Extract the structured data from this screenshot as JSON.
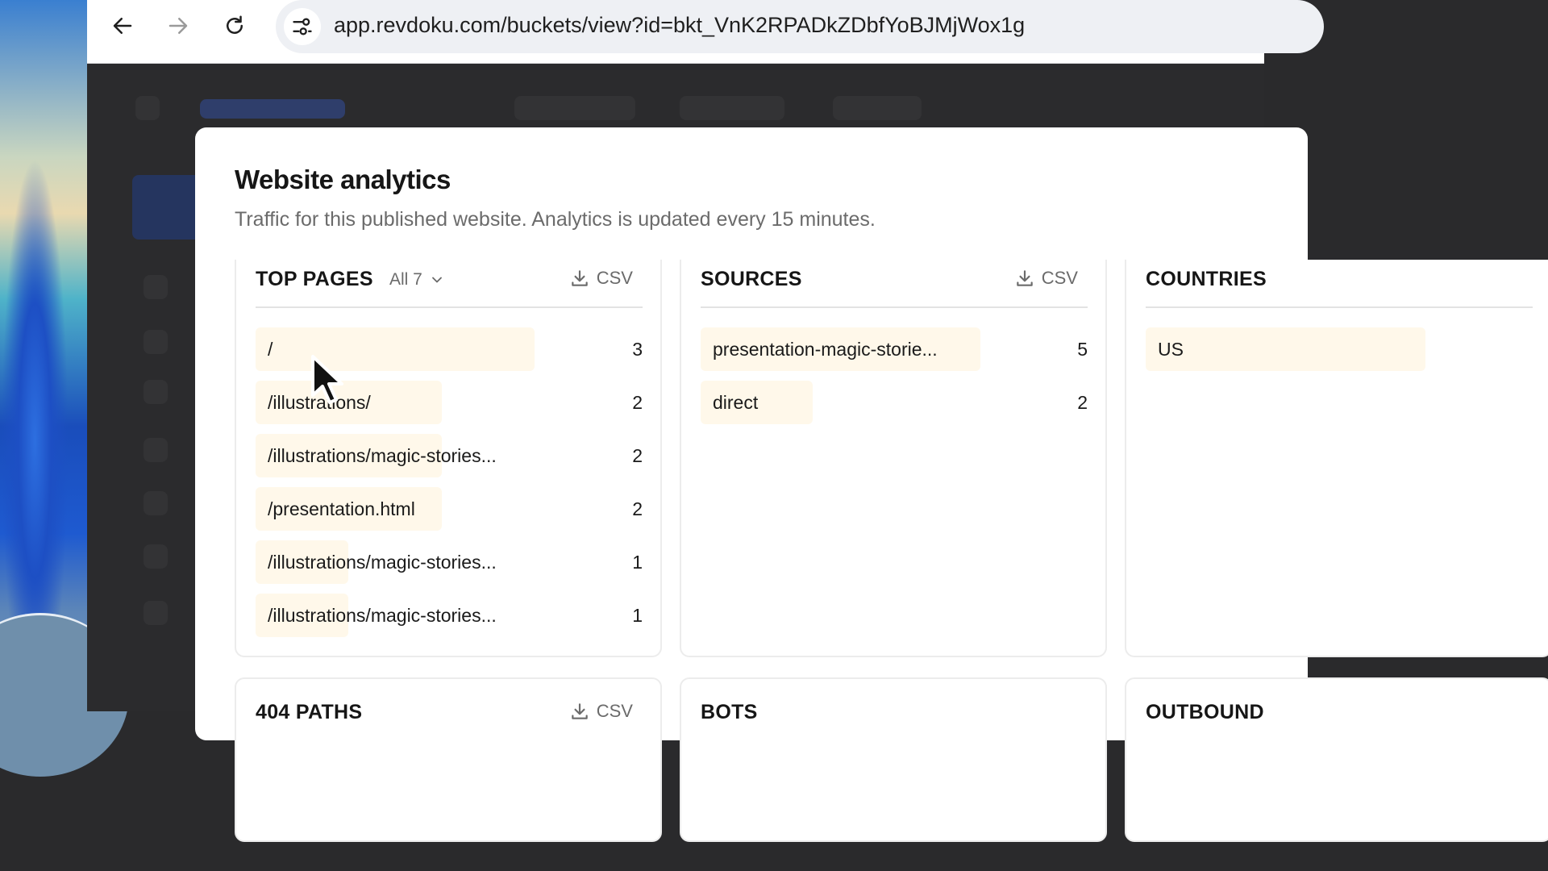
{
  "browser": {
    "url": "app.revdoku.com/buckets/view?id=bkt_VnK2RPADkZDbfYoBJMjWox1g"
  },
  "modal": {
    "title": "Website analytics",
    "subtitle": "Traffic for this published website. Analytics is updated every 15 minutes."
  },
  "top_pages": {
    "title": "TOP PAGES",
    "filter_label": "All 7",
    "csv_label": "CSV",
    "rows": [
      {
        "label": "/",
        "count": "3",
        "share": 1.0
      },
      {
        "label": "/illustrations/",
        "count": "2",
        "share": 0.667
      },
      {
        "label": "/illustrations/magic-stories...",
        "count": "2",
        "share": 0.667
      },
      {
        "label": "/presentation.html",
        "count": "2",
        "share": 0.667
      },
      {
        "label": "/illustrations/magic-stories...",
        "count": "1",
        "share": 0.333
      },
      {
        "label": "/illustrations/magic-stories...",
        "count": "1",
        "share": 0.333
      }
    ]
  },
  "sources": {
    "title": "SOURCES",
    "csv_label": "CSV",
    "rows": [
      {
        "label": "presentation-magic-storie...",
        "count": "5",
        "share": 1.0
      },
      {
        "label": "direct",
        "count": "2",
        "share": 0.4
      }
    ]
  },
  "countries": {
    "title": "COUNTRIES",
    "rows": [
      {
        "label": "US",
        "count": "",
        "share": 1.0
      }
    ]
  },
  "paths_404": {
    "title": "404 PATHS",
    "csv_label": "CSV"
  },
  "bots": {
    "title": "BOTS"
  },
  "outbound": {
    "title": "OUTBOUND"
  },
  "colors": {
    "bar_fill": "#fff8ea",
    "text_primary": "#161616",
    "text_muted": "#6b6b6b"
  }
}
